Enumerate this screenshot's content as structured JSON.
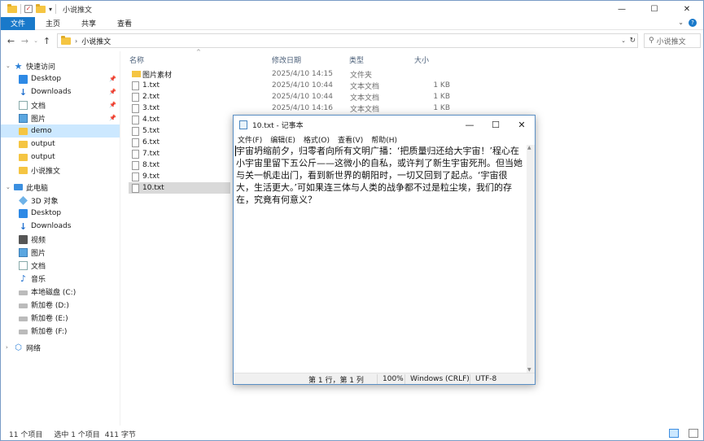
{
  "explorer": {
    "title": "小说推文",
    "window_controls": {
      "minimize": "—",
      "maximize": "☐",
      "close": "✕"
    },
    "ribbon_tabs": [
      "文件",
      "主页",
      "共享",
      "查看"
    ],
    "address": {
      "path_segment": "小说推文"
    },
    "search": {
      "placeholder": "搜索\"小说推文\"",
      "visible_text": "小说推文"
    },
    "sidebar": {
      "quick_access": "快速访问",
      "quick_items": [
        "Desktop",
        "Downloads",
        "文档",
        "图片",
        "demo",
        "output",
        "output",
        "小说推文"
      ],
      "this_pc": "此电脑",
      "pc_items": [
        "3D 对象",
        "Desktop",
        "Downloads",
        "视频",
        "图片",
        "文档",
        "音乐",
        "本地磁盘 (C:)",
        "新加卷 (D:)",
        "新加卷 (E:)",
        "新加卷 (F:)"
      ],
      "network": "网络"
    },
    "columns": {
      "name": "名称",
      "date": "修改日期",
      "type": "类型",
      "size": "大小"
    },
    "files": [
      {
        "name": "图片素材",
        "date": "2025/4/10 14:15",
        "type": "文件夹",
        "size": ""
      },
      {
        "name": "1.txt",
        "date": "2025/4/10 10:44",
        "type": "文本文档",
        "size": "1 KB"
      },
      {
        "name": "2.txt",
        "date": "2025/4/10 10:44",
        "type": "文本文档",
        "size": "1 KB"
      },
      {
        "name": "3.txt",
        "date": "2025/4/10 14:16",
        "type": "文本文档",
        "size": "1 KB"
      },
      {
        "name": "4.txt",
        "date": "",
        "type": "",
        "size": ""
      },
      {
        "name": "5.txt",
        "date": "",
        "type": "",
        "size": ""
      },
      {
        "name": "6.txt",
        "date": "",
        "type": "",
        "size": ""
      },
      {
        "name": "7.txt",
        "date": "",
        "type": "",
        "size": ""
      },
      {
        "name": "8.txt",
        "date": "",
        "type": "",
        "size": ""
      },
      {
        "name": "9.txt",
        "date": "",
        "type": "",
        "size": ""
      },
      {
        "name": "10.txt",
        "date": "",
        "type": "",
        "size": ""
      }
    ],
    "status": {
      "count": "11 个项目",
      "selected": "选中 1 个项目",
      "bytes": "411 字节"
    }
  },
  "notepad": {
    "title": "10.txt - 记事本",
    "menu": [
      "文件(F)",
      "编辑(E)",
      "格式(O)",
      "查看(V)",
      "帮助(H)"
    ],
    "content": "宇宙坍缩前夕，归零者向所有文明广播：‘把质量归还给大宇宙！’程心在小宇宙里留下五公斤——这微小的自私，或许判了新生宇宙死刑。但当她与关一帆走出门，看到新世界的朝阳时，一切又回到了起点。‘宇宙很大，生活更大。’可如果连三体与人类的战争都不过是粒尘埃，我们的存在，究竟有何意义？",
    "status": {
      "position": "第 1 行，第 1 列",
      "zoom": "100%",
      "line_ending": "Windows (CRLF)",
      "encoding": "UTF-8"
    }
  }
}
